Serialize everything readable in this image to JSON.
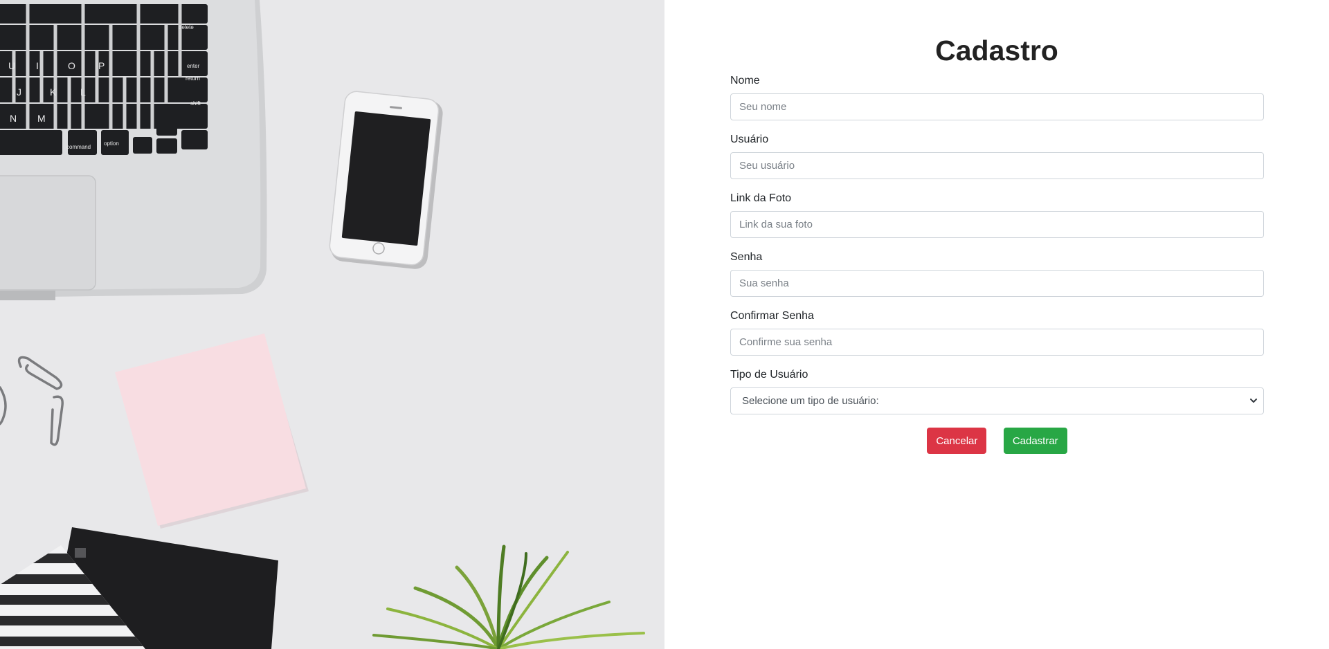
{
  "colors": {
    "top_line": "#1a9a8c",
    "cancel": "#dc3545",
    "submit": "#28a745",
    "hero_bg": "#e8e8ea"
  },
  "form": {
    "title": "Cadastro",
    "fields": [
      {
        "label": "Nome",
        "placeholder": "Seu nome"
      },
      {
        "label": "Usuário",
        "placeholder": "Seu usuário"
      },
      {
        "label": "Link da Foto",
        "placeholder": "Link da sua foto"
      },
      {
        "label": "Senha",
        "placeholder": "Sua senha"
      },
      {
        "label": "Confirmar Senha",
        "placeholder": "Confirme sua senha"
      }
    ],
    "user_type": {
      "label": "Tipo de Usuário",
      "selected": "Selecione um tipo de usuário:"
    },
    "buttons": {
      "cancel": "Cancelar",
      "submit": "Cadastrar"
    }
  },
  "hero": {
    "keyboard_labels": [
      "delete",
      "enter",
      "return",
      "shift",
      "command",
      "option"
    ],
    "icons": [
      "laptop-illustration",
      "smartphone-illustration",
      "sticky-note-illustration",
      "paperclip-icon",
      "notebook-illustration",
      "plant-illustration"
    ]
  }
}
